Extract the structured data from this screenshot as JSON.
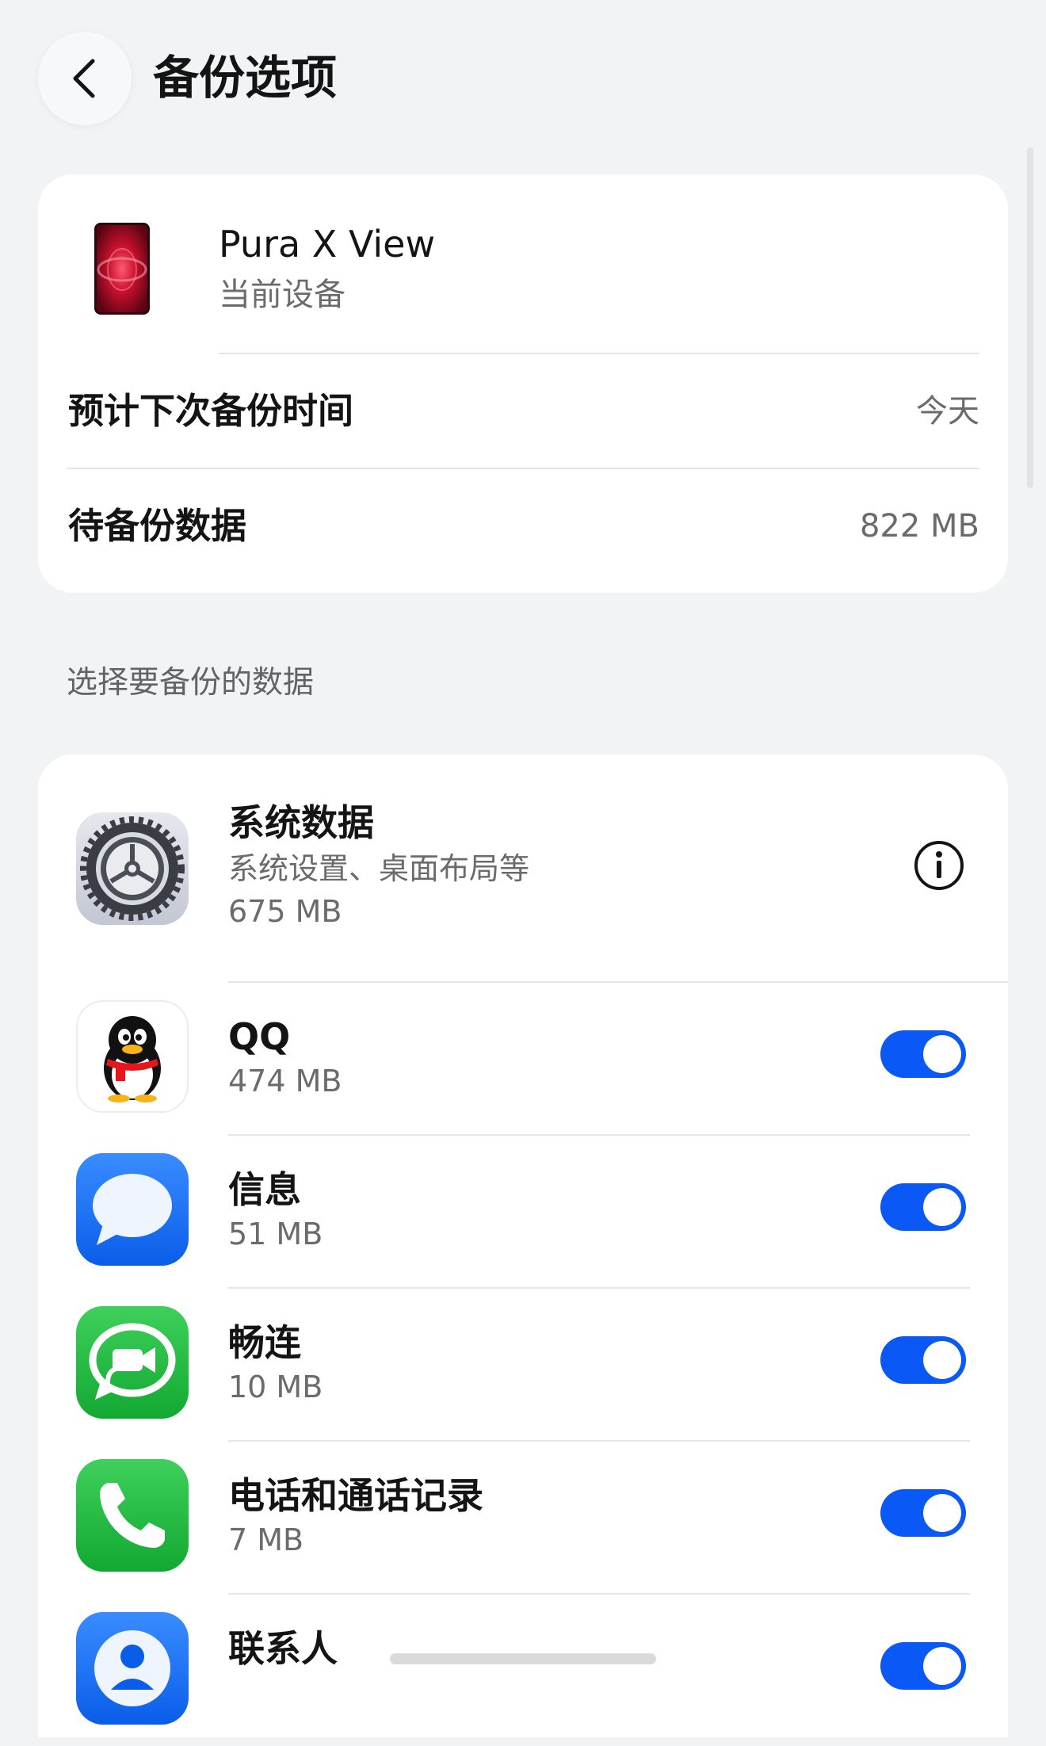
{
  "header": {
    "title": "备份选项",
    "back_icon": "chevron-left-icon"
  },
  "device_card": {
    "device_name": "Pura X View",
    "device_sub": "当前设备",
    "next_backup_label": "预计下次备份时间",
    "next_backup_value": "今天",
    "pending_label": "待备份数据",
    "pending_value": "822 MB"
  },
  "section": {
    "title": "选择要备份的数据"
  },
  "apps": [
    {
      "name": "系统数据",
      "desc": "系统设置、桌面布局等",
      "size": "675 MB",
      "icon": "settings-gear-icon",
      "control": "info"
    },
    {
      "name": "QQ",
      "size": "474 MB",
      "icon": "qq-penguin-icon",
      "enabled": true
    },
    {
      "name": "信息",
      "size": "51 MB",
      "icon": "messages-bubble-icon",
      "enabled": true
    },
    {
      "name": "畅连",
      "size": "10 MB",
      "icon": "meetime-video-icon",
      "enabled": true
    },
    {
      "name": "电话和通话记录",
      "size": "7 MB",
      "icon": "phone-handset-icon",
      "enabled": true
    },
    {
      "name": "联系人",
      "icon": "contacts-person-icon",
      "enabled": true
    }
  ],
  "colors": {
    "accent": "#0a59f7",
    "background": "#f1f3f5",
    "card": "#ffffff",
    "secondary_text": "#6b6b6b"
  }
}
